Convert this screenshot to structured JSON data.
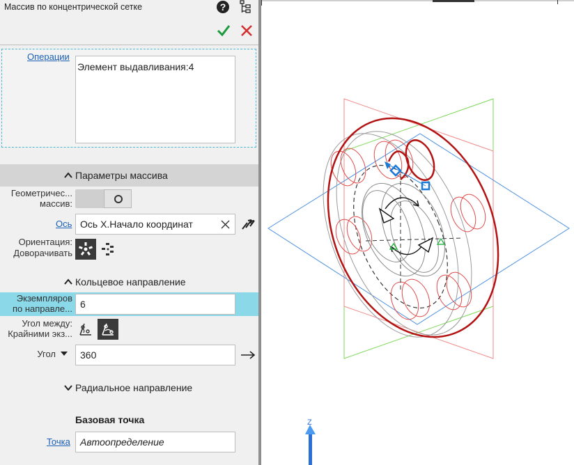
{
  "header": {
    "title": "Массив по концентрической сетке",
    "help_icon": "question-circle-icon",
    "tree_icon": "tree-structure-icon",
    "ok_icon": "checkmark-icon",
    "cancel_icon": "close-x-icon",
    "ok_color": "#1a9a3c",
    "cancel_color": "#d32f2f"
  },
  "operations": {
    "label": "Операции",
    "list_items": [
      "Элемент выдавливания:4"
    ]
  },
  "array_params": {
    "header": "Параметры массива",
    "geometric_label_1": "Геометричес...",
    "geometric_label_2": "массив:",
    "axis_label": "Ось",
    "axis_value": "Ось X.Начало координат",
    "orientation_label": "Ориентация:",
    "orientation_value_label": "Доворачивать"
  },
  "ring_direction": {
    "header": "Кольцевое направление",
    "count_label_1": "Экземпляров",
    "count_label_2": "по направле...",
    "count_value": "6",
    "angle_between_label_1": "Угол между:",
    "angle_between_label_2": "Крайними экз...",
    "angle_label": "Угол",
    "angle_value": "360"
  },
  "radial_direction": {
    "header": "Радиальное направление"
  },
  "base_point": {
    "header": "Базовая точка",
    "point_label": "Точка",
    "point_value": "Автоопределение"
  },
  "viewport": {
    "axis_label": "Z"
  }
}
